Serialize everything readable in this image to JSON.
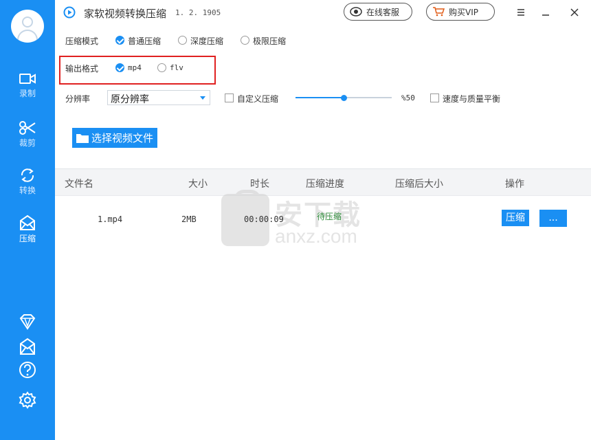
{
  "app": {
    "title": "家软视频转换压缩",
    "version": "1. 2. 1905",
    "online_service": "在线客服",
    "buy_vip": "购买VIP"
  },
  "sidebar": {
    "items": [
      {
        "label": "录制",
        "icon": "video-camera-icon"
      },
      {
        "label": "裁剪",
        "icon": "scissors-icon"
      },
      {
        "label": "转换",
        "icon": "convert-arrows-icon"
      },
      {
        "label": "压缩",
        "icon": "compress-envelope-icon",
        "active": true
      }
    ],
    "bottom_icons": [
      "vip-diamond-icon",
      "compress-envelope-icon",
      "help-icon",
      "settings-gear-icon"
    ]
  },
  "options": {
    "mode_label": "压缩模式",
    "modes": [
      {
        "label": "普通压缩",
        "checked": true
      },
      {
        "label": "深度压缩",
        "checked": false
      },
      {
        "label": "极限压缩",
        "checked": false
      }
    ],
    "format_label": "输出格式",
    "formats": [
      {
        "label": "mp4",
        "checked": true
      },
      {
        "label": "flv",
        "checked": false
      }
    ],
    "resolution_label": "分辨率",
    "resolution_value": "原分辨率",
    "custom_label": "自定义压缩",
    "custom_checked": false,
    "slider_value": 50,
    "slider_text": "%50",
    "balance_label": "速度与质量平衡",
    "balance_checked": false
  },
  "choose_button": "选择视频文件",
  "table": {
    "headers": [
      "文件名",
      "大小",
      "时长",
      "压缩进度",
      "压缩后大小",
      "操作"
    ],
    "rows": [
      {
        "name": "1.mp4",
        "size": "2MB",
        "duration": "00:00:09",
        "status": "待压缩",
        "compressed_size": "",
        "compress_btn": "压缩",
        "more_btn": "..."
      }
    ]
  },
  "watermark": {
    "name": "安下载",
    "domain": "anxz.com"
  },
  "colors": {
    "accent": "#1a8ff3",
    "highlight": "#e02020",
    "status": "#2e8b3a"
  }
}
